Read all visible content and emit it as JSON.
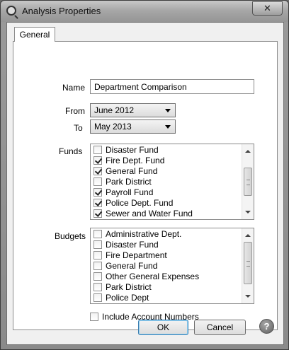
{
  "window": {
    "title": "Analysis Properties",
    "close_glyph": "✕"
  },
  "tabs": [
    {
      "label": "General"
    }
  ],
  "form": {
    "name_label": "Name",
    "name_value": "Department Comparison",
    "from_label": "From",
    "from_value": "June 2012",
    "to_label": "To",
    "to_value": "May 2013",
    "funds_label": "Funds",
    "budgets_label": "Budgets",
    "include_label": "Include Account Numbers",
    "include_checked": false
  },
  "funds": [
    {
      "label": "Disaster Fund",
      "checked": false
    },
    {
      "label": "Fire Dept. Fund",
      "checked": true
    },
    {
      "label": "General Fund",
      "checked": true
    },
    {
      "label": "Park District",
      "checked": false
    },
    {
      "label": "Payroll Fund",
      "checked": true
    },
    {
      "label": "Police Dept. Fund",
      "checked": true
    },
    {
      "label": "Sewer and Water Fund",
      "checked": true
    }
  ],
  "budgets": [
    {
      "label": "Administrative Dept.",
      "checked": false
    },
    {
      "label": "Disaster Fund",
      "checked": false
    },
    {
      "label": "Fire Department",
      "checked": false
    },
    {
      "label": "General Fund",
      "checked": false
    },
    {
      "label": "Other General Expenses",
      "checked": false
    },
    {
      "label": "Park District",
      "checked": false
    },
    {
      "label": "Police Dept",
      "checked": false
    }
  ],
  "buttons": {
    "ok": "OK",
    "cancel": "Cancel",
    "help": "?"
  }
}
